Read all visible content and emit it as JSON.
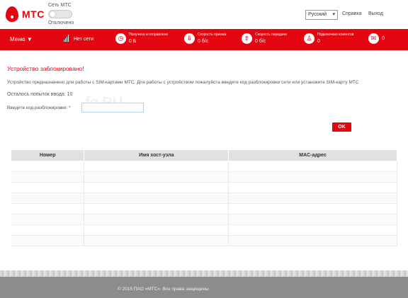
{
  "header": {
    "logo_text": "МТС",
    "network_label": "Сеть МТС",
    "network_status": "Отключено",
    "language": "Русский",
    "help_link": "Справка",
    "logout_link": "Выход"
  },
  "navbar": {
    "menu_label": "Меню",
    "signal_text": "Нет сети",
    "stats": [
      {
        "icon": "clock-icon",
        "glyph": "◷",
        "title": "Получено и отправлено",
        "value": "0 Б"
      },
      {
        "icon": "download-icon",
        "glyph": "⇩",
        "title": "Скорость приема",
        "value": "0 б/с"
      },
      {
        "icon": "upload-icon",
        "glyph": "⇧",
        "title": "Скорость передачи",
        "value": "0 б/с"
      },
      {
        "icon": "users-icon",
        "glyph": "♙",
        "title": "Подключено клиентов",
        "value": "0"
      },
      {
        "icon": "mail-icon",
        "glyph": "✉",
        "title": "",
        "value": "0"
      }
    ]
  },
  "main": {
    "title": "Устройство заблокировано!",
    "description": "Устройство предназначено для работы с SIM-картами МТС. Для работы с устройством пожалуйста введите код разблокировки сети или установите SIM-карту МТС",
    "attempts": "Осталось попыток ввода: 10",
    "code_label": "Введите код разблокировки:",
    "required_mark": "*",
    "watermark": "fo.RU",
    "ok_button": "OK"
  },
  "clients_table": {
    "headers": [
      "Номер",
      "Имя хост-узла",
      "MAC-адрес"
    ],
    "rows": [
      [
        "",
        "",
        ""
      ],
      [
        "",
        "",
        ""
      ],
      [
        "",
        "",
        ""
      ],
      [
        "",
        "",
        ""
      ],
      [
        "",
        "",
        ""
      ],
      [
        "",
        "",
        ""
      ],
      [
        "",
        "",
        ""
      ],
      [
        "",
        "",
        ""
      ]
    ]
  },
  "footer": {
    "copyright": "© 2015 ПАО «МТС». Все права защищены"
  },
  "colors": {
    "brand_red": "#e30611",
    "footer_gray": "#8c8c8c"
  }
}
